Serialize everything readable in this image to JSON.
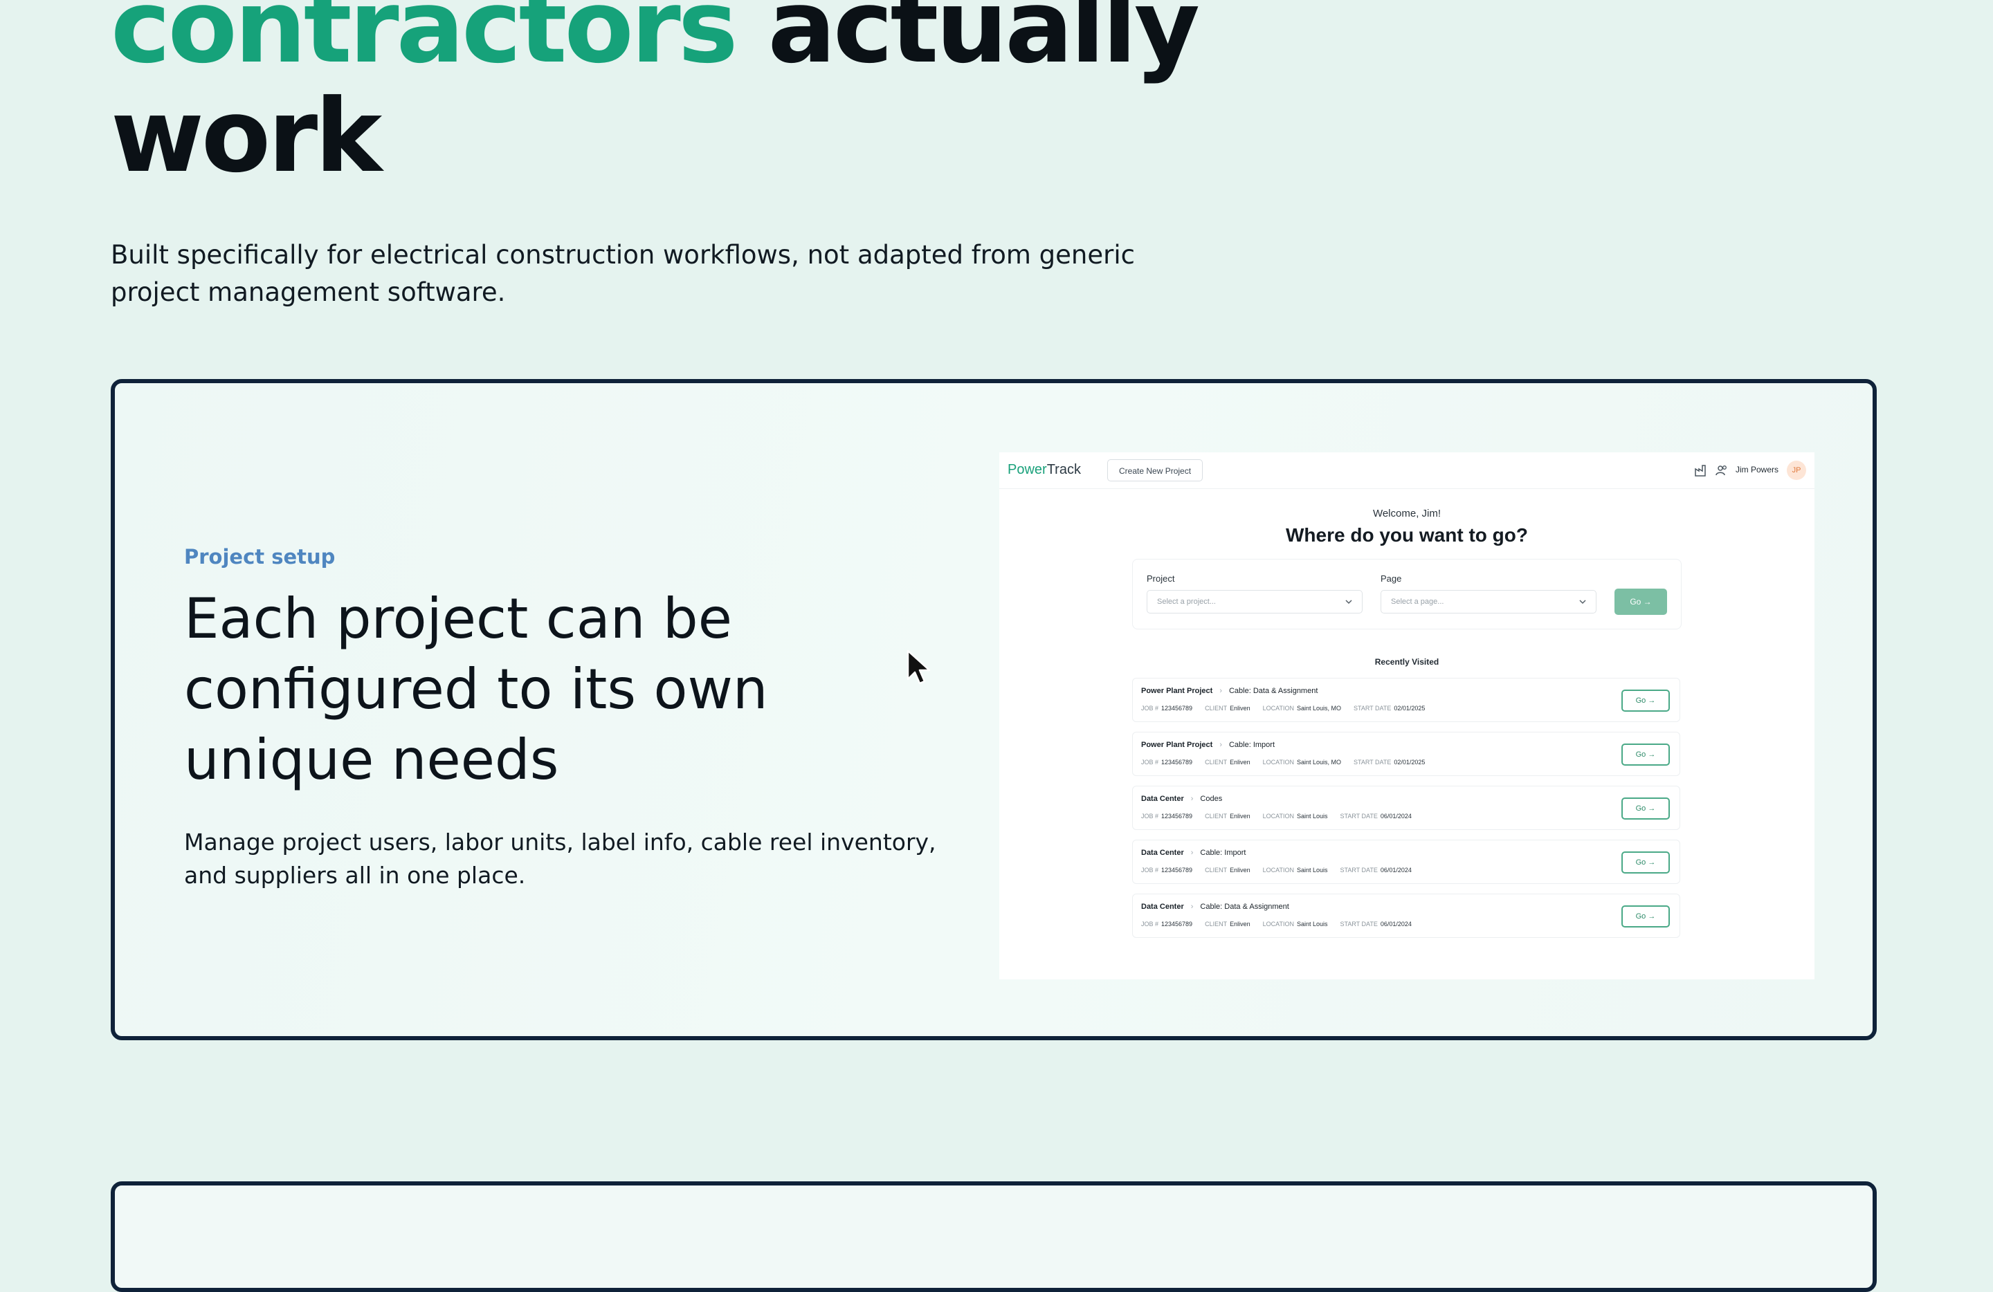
{
  "hero": {
    "headline_accent": "contractors",
    "headline_rest": " actually",
    "headline_line2": "work",
    "subtitle": "Built specifically for electrical construction workflows, not adapted from generic project management software."
  },
  "feature": {
    "eyebrow": "Project setup",
    "title": "Each project can be configured to its own unique needs",
    "description": "Manage project users, labor units, label info, cable reel inventory, and suppliers all in one place."
  },
  "app": {
    "logo_a": "Power",
    "logo_b": "Track",
    "create_button": "Create New Project",
    "user_name": "Jim Powers",
    "user_initials": "JP",
    "welcome": "Welcome, Jim!",
    "title": "Where do you want to go?",
    "project_label": "Project",
    "project_placeholder": "Select a project...",
    "page_label": "Page",
    "page_placeholder": "Select a page...",
    "go_label": "Go →",
    "recent_title": "Recently Visited",
    "meta_keys": {
      "job": "JOB #",
      "client": "CLIENT",
      "location": "LOCATION",
      "start": "START DATE"
    },
    "recent": [
      {
        "project": "Power Plant Project",
        "page": "Cable: Data & Assignment",
        "job": "123456789",
        "client": "Enliven",
        "location": "Saint Louis, MO",
        "start": "02/01/2025",
        "go": "Go →"
      },
      {
        "project": "Power Plant Project",
        "page": "Cable: Import",
        "job": "123456789",
        "client": "Enliven",
        "location": "Saint Louis, MO",
        "start": "02/01/2025",
        "go": "Go →"
      },
      {
        "project": "Data Center",
        "page": "Codes",
        "job": "123456789",
        "client": "Enliven",
        "location": "Saint Louis",
        "start": "06/01/2024",
        "go": "Go →"
      },
      {
        "project": "Data Center",
        "page": "Cable: Import",
        "job": "123456789",
        "client": "Enliven",
        "location": "Saint Louis",
        "start": "06/01/2024",
        "go": "Go →"
      },
      {
        "project": "Data Center",
        "page": "Cable: Data & Assignment",
        "job": "123456789",
        "client": "Enliven",
        "location": "Saint Louis",
        "start": "06/01/2024",
        "go": "Go →"
      }
    ]
  }
}
